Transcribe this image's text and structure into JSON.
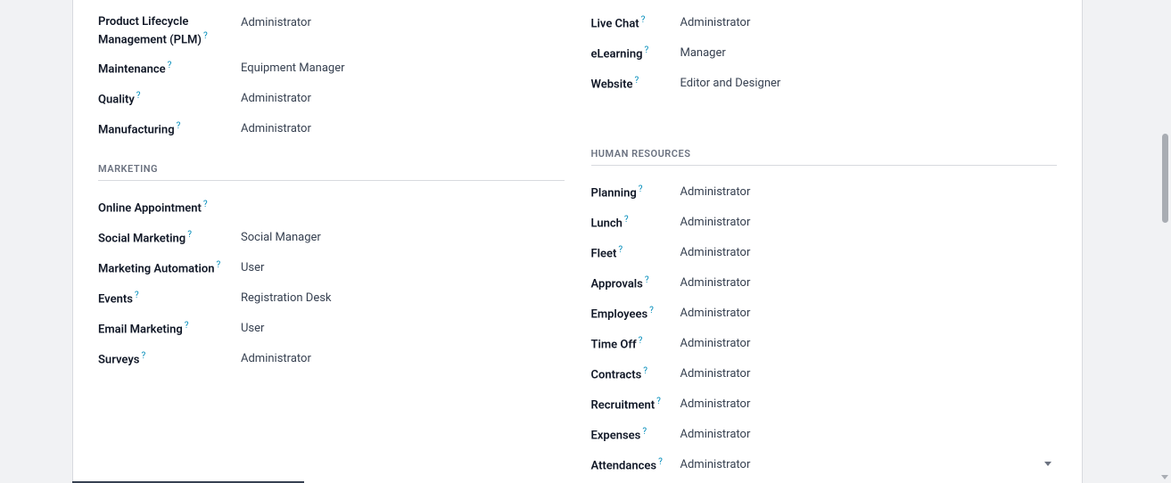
{
  "help_glyph": "?",
  "left_top": {
    "rows": [
      {
        "label": "Product Lifecycle Management (PLM)",
        "help": true,
        "value": "Administrator"
      },
      {
        "label": "Maintenance",
        "help": true,
        "value": "Equipment Manager"
      },
      {
        "label": "Quality",
        "help": true,
        "value": "Administrator"
      },
      {
        "label": "Manufacturing",
        "help": true,
        "value": "Administrator"
      }
    ]
  },
  "right_top": {
    "rows": [
      {
        "label": "Live Chat",
        "help": true,
        "value": "Administrator"
      },
      {
        "label": "eLearning",
        "help": true,
        "value": "Manager"
      },
      {
        "label": "Website",
        "help": true,
        "value": "Editor and Designer"
      }
    ]
  },
  "left_section": {
    "title": "MARKETING",
    "rows": [
      {
        "label": "Online Appointment",
        "help": true,
        "value": ""
      },
      {
        "label": "Social Marketing",
        "help": true,
        "value": "Social Manager"
      },
      {
        "label": "Marketing Automation",
        "help": true,
        "value": "User"
      },
      {
        "label": "Events",
        "help": true,
        "value": "Registration Desk"
      },
      {
        "label": "Email Marketing",
        "help": true,
        "value": "User"
      },
      {
        "label": "Surveys",
        "help": true,
        "value": "Administrator"
      }
    ]
  },
  "right_section": {
    "title": "HUMAN RESOURCES",
    "rows": [
      {
        "label": "Planning",
        "help": true,
        "value": "Administrator"
      },
      {
        "label": "Lunch",
        "help": true,
        "value": "Administrator"
      },
      {
        "label": "Fleet",
        "help": true,
        "value": "Administrator"
      },
      {
        "label": "Approvals",
        "help": true,
        "value": "Administrator"
      },
      {
        "label": "Employees",
        "help": true,
        "value": "Administrator"
      },
      {
        "label": "Time Off",
        "help": true,
        "value": "Administrator"
      },
      {
        "label": "Contracts",
        "help": true,
        "value": "Administrator"
      },
      {
        "label": "Recruitment",
        "help": true,
        "value": "Administrator"
      },
      {
        "label": "Expenses",
        "help": true,
        "value": "Administrator"
      },
      {
        "label": "Attendances",
        "help": true,
        "value": "Administrator",
        "caret": true
      }
    ]
  }
}
